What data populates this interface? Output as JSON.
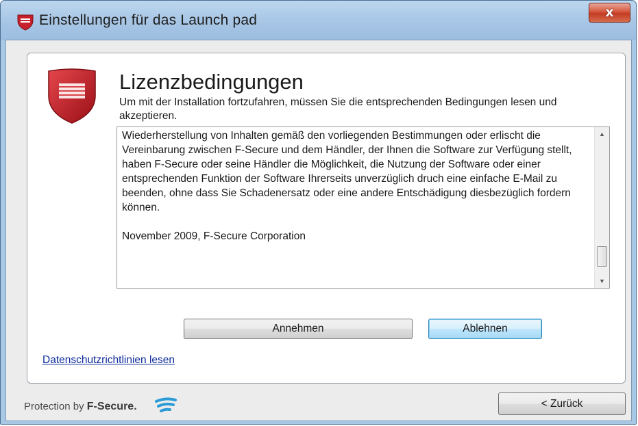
{
  "window": {
    "title": "Einstellungen für das Launch pad",
    "close_label": "x"
  },
  "page": {
    "heading": "Lizenzbedingungen",
    "description": "Um mit der Installation fortzufahren, müssen Sie die entsprechenden Bedingungen lesen und akzeptieren."
  },
  "license": {
    "text": "Wiederherstellung von Inhalten gemäß den vorliegenden Bestimmungen oder erlischt die Vereinbarung zwischen F-Secure und dem Händler, der Ihnen die Software zur Verfügung stellt, haben F-Secure oder seine Händler die Möglichkeit, die Nutzung der Software oder einer entsprechenden Funktion der Software Ihrerseits unverzüglich druch eine einfache E-Mail zu beenden, ohne dass Sie Schadenersatz oder eine andere Entschädigung diesbezüglich fordern können.\n\nNovember 2009, F-Secure Corporation"
  },
  "buttons": {
    "accept": "Annehmen",
    "decline": "Ablehnen",
    "back": "< Zurück"
  },
  "links": {
    "privacy": "Datenschutzrichtlinien lesen"
  },
  "footer": {
    "brand_prefix": "Protection by",
    "brand_name": "F-Secure."
  },
  "colors": {
    "shield_red": "#c8202a",
    "link_blue": "#0b2a9b"
  }
}
